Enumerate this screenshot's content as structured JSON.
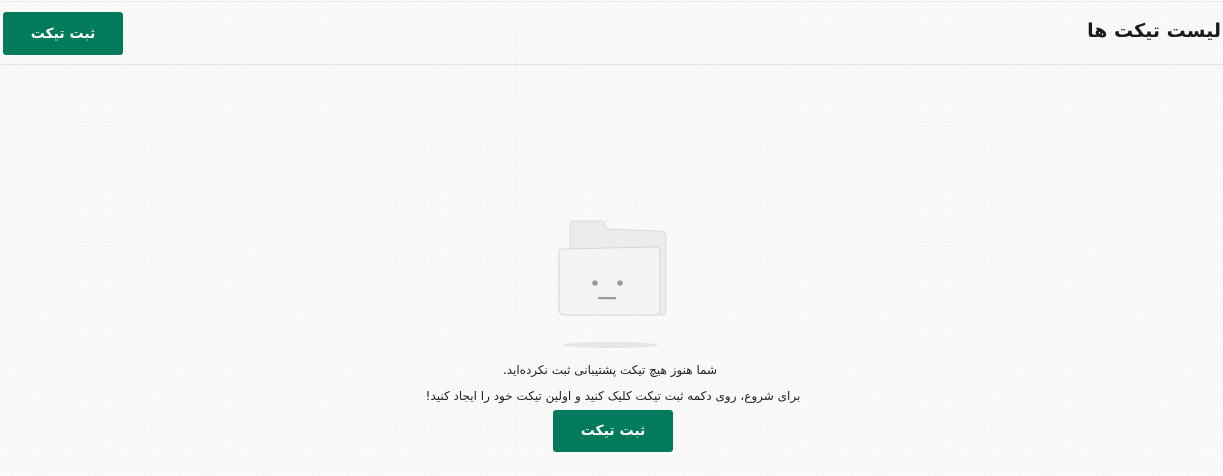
{
  "header": {
    "title": "لیست تیکت ها",
    "create_button_label": "ثبت تیکت"
  },
  "empty_state": {
    "illustration": "empty-folder-icon",
    "line1": "شما هنوز هیچ تیکت پشتیبانی ثبت نکرده‌اید.",
    "line2": "برای شروع، روی دکمه ثبت تیکت کلیک کنید و اولین تیکت خود را ایجاد کنید!",
    "create_button_label": "ثبت تیکت"
  },
  "colors": {
    "primary": "#027a5b",
    "accent_blob": "#8fd1b6",
    "background": "#fafaf9"
  }
}
